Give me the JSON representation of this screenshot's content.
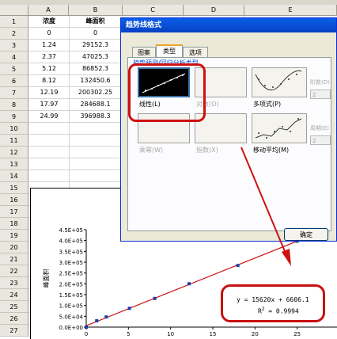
{
  "sheet": {
    "columns": [
      "A",
      "B",
      "C",
      "D",
      "E"
    ],
    "rows": [
      "1",
      "2",
      "3",
      "4",
      "5",
      "6",
      "7",
      "8",
      "9",
      "10",
      "11",
      "12",
      "13",
      "14",
      "15",
      "16",
      "17",
      "18",
      "19",
      "20",
      "21",
      "22",
      "23",
      "24",
      "25",
      "26",
      "27"
    ],
    "header_row": [
      "浓度",
      "峰面积"
    ],
    "data": [
      [
        "0",
        "0"
      ],
      [
        "1.24",
        "29152.3"
      ],
      [
        "2.37",
        "47025.3"
      ],
      [
        "5.12",
        "86852.3"
      ],
      [
        "8.12",
        "132450.6"
      ],
      [
        "12.19",
        "200302.25"
      ],
      [
        "17.97",
        "284688.1"
      ],
      [
        "24.99",
        "396988.3"
      ]
    ]
  },
  "chart_data": {
    "type": "scatter",
    "x": [
      0,
      1.24,
      2.37,
      5.12,
      8.12,
      12.19,
      17.97,
      24.99
    ],
    "y": [
      0,
      29152.3,
      47025.3,
      86852.3,
      132450.6,
      200302.25,
      284688.1,
      396988.3
    ],
    "trendline": {
      "slope": 15620,
      "intercept": 6606.1
    },
    "ylabel": "峰面积",
    "ytick_labels": [
      "4.5E+05",
      "4.0E+05",
      "3.5E+05",
      "3.0E+05",
      "2.5E+05",
      "2.0E+05",
      "1.5E+05",
      "1.0E+05",
      "5.0E+04",
      "0.0E+00"
    ],
    "xtick_labels": [
      "0",
      "5",
      "10",
      "15",
      "20",
      "25"
    ],
    "ylim": [
      0,
      450000
    ],
    "xlim": [
      0,
      30
    ],
    "marker_color": "#1a3fa8",
    "line_color": "#cc1111"
  },
  "equation": {
    "line1": "y = 15620x + 6606.1",
    "r2_prefix": "R",
    "r2_sup": "2",
    "r2_value": " = 0.9994"
  },
  "dialog": {
    "title": "趋势线格式",
    "tabs": [
      "图案",
      "类型",
      "选项"
    ],
    "active_tab": 1,
    "group_label": "趋势预测/回归分析类型",
    "types": [
      {
        "label": "线性(L)"
      },
      {
        "label": "对数(O)"
      },
      {
        "label": "多项式(P)"
      },
      {
        "label": "乘幂(W)"
      },
      {
        "label": "指数(X)"
      },
      {
        "label": "移动平均(M)"
      }
    ],
    "order_label": "阶数(D)",
    "order_value": "2",
    "period_label": "周期(E)",
    "period_value": "2",
    "ok_label": "确定"
  },
  "colors": {
    "annotation_red": "#d01010",
    "title_blue": "#0842c4"
  }
}
